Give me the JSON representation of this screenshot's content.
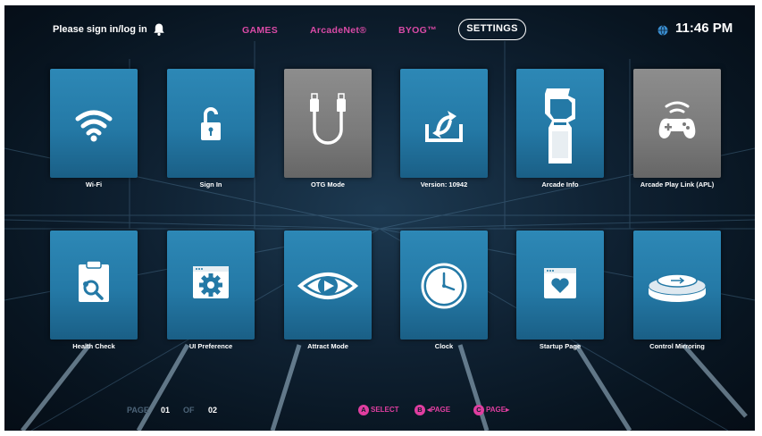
{
  "header": {
    "signin_text": "Please sign in/log in",
    "nav": [
      "GAMES",
      "ArcadeNet®",
      "BYOG™",
      "SETTINGS"
    ],
    "time": "11:46 PM"
  },
  "tiles": [
    {
      "label": "Wi-Fi",
      "icon": "wifi-icon"
    },
    {
      "label": "Sign In",
      "icon": "padlock-icon"
    },
    {
      "label": "OTG Mode",
      "icon": "usb-cable-icon"
    },
    {
      "label": "Version: 10942",
      "icon": "update-icon"
    },
    {
      "label": "Arcade Info",
      "icon": "arcade-cabinet-icon"
    },
    {
      "label": "Arcade Play Link (APL)",
      "icon": "gamepad-wireless-icon"
    },
    {
      "label": "Health Check",
      "icon": "clipboard-search-icon"
    },
    {
      "label": "UI Preference",
      "icon": "window-gear-icon"
    },
    {
      "label": "Attract Mode",
      "icon": "eye-play-icon"
    },
    {
      "label": "Clock",
      "icon": "clock-icon"
    },
    {
      "label": "Startup Page",
      "icon": "window-heart-icon"
    },
    {
      "label": "Control Mirroring",
      "icon": "button-mirror-icon"
    }
  ],
  "footer": {
    "page_label": "PAGE",
    "page_current": "01",
    "of_label": "OF",
    "page_total": "02",
    "hints": [
      {
        "button": "A",
        "text": "SELECT"
      },
      {
        "button": "B",
        "text": "◂PAGE"
      },
      {
        "button": "C",
        "text": "PAGE▸"
      }
    ]
  },
  "colors": {
    "accent": "#e03ea0",
    "tile": "#2479a6",
    "tile_selected": "#7a7a7a"
  }
}
